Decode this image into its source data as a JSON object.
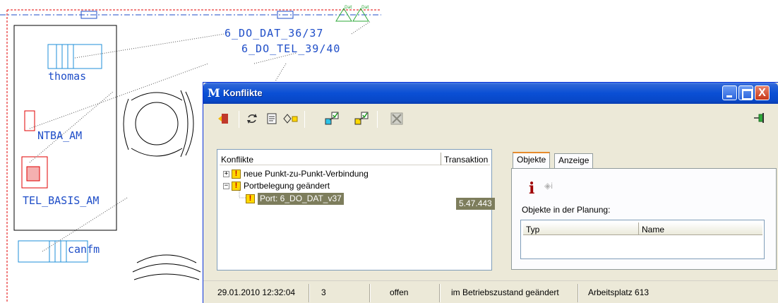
{
  "cad": {
    "plan_labels": [
      "6_DO_DAT_36/37",
      "6_DO_TEL_39/40"
    ],
    "devices": {
      "thomas": "thomas",
      "ntba": "NTBA_AM",
      "telbasis": "TEL_BASIS_AM",
      "canfm": "canfm"
    },
    "header_marks": [
      "Dat",
      "Dat"
    ]
  },
  "window": {
    "title": "Konflikte",
    "close_glyph": "X"
  },
  "toolbar": {
    "icons": [
      "exit-door-icon",
      "refresh-icon",
      "document-icon",
      "diamond-warning-icon",
      "assign-green-icon",
      "assign-yellow-icon",
      "disabled-x-icon"
    ],
    "pin_icon": "pin-icon"
  },
  "conflicts": {
    "col_konflikte": "Konflikte",
    "col_transaktion": "Transaktion",
    "items": [
      {
        "expander": "+",
        "label": "neue Punkt-zu-Punkt-Verbindung"
      },
      {
        "expander": "−",
        "label": "Portbelegung geändert"
      }
    ],
    "child": {
      "label": "Port: 6_DO_DAT_v37",
      "transaction": "5.47.443"
    },
    "warn_glyph": "!"
  },
  "tabs": {
    "objekte": "Objekte",
    "anzeige": "Anzeige"
  },
  "objects_page": {
    "info_glyph": "i",
    "info_gray_glyph": "◈i",
    "label": "Objekte in der Planung:",
    "col_typ": "Typ",
    "col_name": "Name"
  },
  "status": {
    "datetime": "29.01.2010 12:32:04",
    "count": "3",
    "state": "offen",
    "mode": "im Betriebszustand geändert",
    "workplace": "Arbeitsplatz 613"
  },
  "colors": {
    "cad_blue": "#1f4ec8",
    "cad_red": "#e00000",
    "selection": "#7d7d5c",
    "xp_blue": "#0a4fd5"
  }
}
